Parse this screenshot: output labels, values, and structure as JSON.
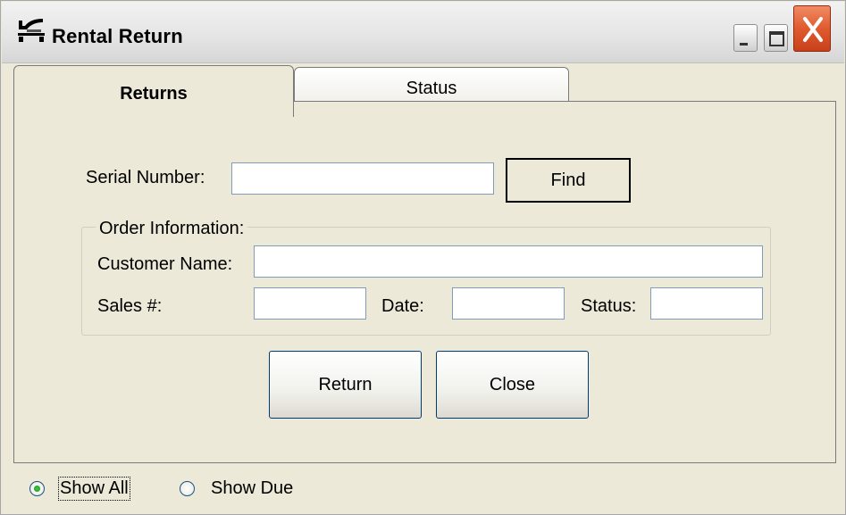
{
  "window": {
    "title": "Rental Return",
    "icons": {
      "app": "scanner-icon",
      "minimize": "minimize-icon",
      "maximize": "maximize-icon",
      "close": "close-icon"
    }
  },
  "tabs": [
    {
      "label": "Returns",
      "selected": true
    },
    {
      "label": "Status",
      "selected": false
    }
  ],
  "returns": {
    "serial_label": "Serial Number:",
    "serial_value": "",
    "find_label": "Find",
    "order_group_label": "Order Information:",
    "customer_label": "Customer Name:",
    "customer_value": "",
    "sales_label": "Sales #:",
    "sales_value": "",
    "date_label": "Date:",
    "date_value": "",
    "status_label": "Status:",
    "status_value": "",
    "return_label": "Return",
    "close_label": "Close"
  },
  "filter": {
    "show_all_label": "Show All",
    "show_due_label": "Show Due",
    "selected": "Show All"
  },
  "colors": {
    "window_bg": "#ece9d8",
    "close_button": "#e05a2f",
    "field_border": "#7f9db9",
    "button_border": "#003c74"
  }
}
